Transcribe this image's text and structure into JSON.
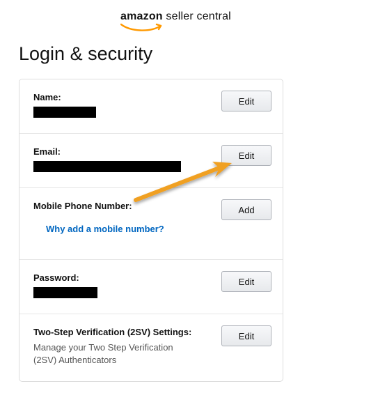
{
  "header": {
    "brand_bold": "amazon",
    "brand_rest": " seller central"
  },
  "title": "Login & security",
  "rows": {
    "name": {
      "label": "Name:",
      "value": "████████",
      "button": "Edit"
    },
    "email": {
      "label": "Email:",
      "value": "██████████████████████",
      "button": "Edit"
    },
    "phone": {
      "label": "Mobile Phone Number:",
      "link": "Why add a mobile number?",
      "button": "Add"
    },
    "password": {
      "label": "Password:",
      "value": "████████",
      "button": "Edit"
    },
    "twosv": {
      "label": "Two-Step Verification (2SV) Settings:",
      "desc": "Manage your Two Step Verification (2SV) Authenticators",
      "button": "Edit"
    }
  }
}
